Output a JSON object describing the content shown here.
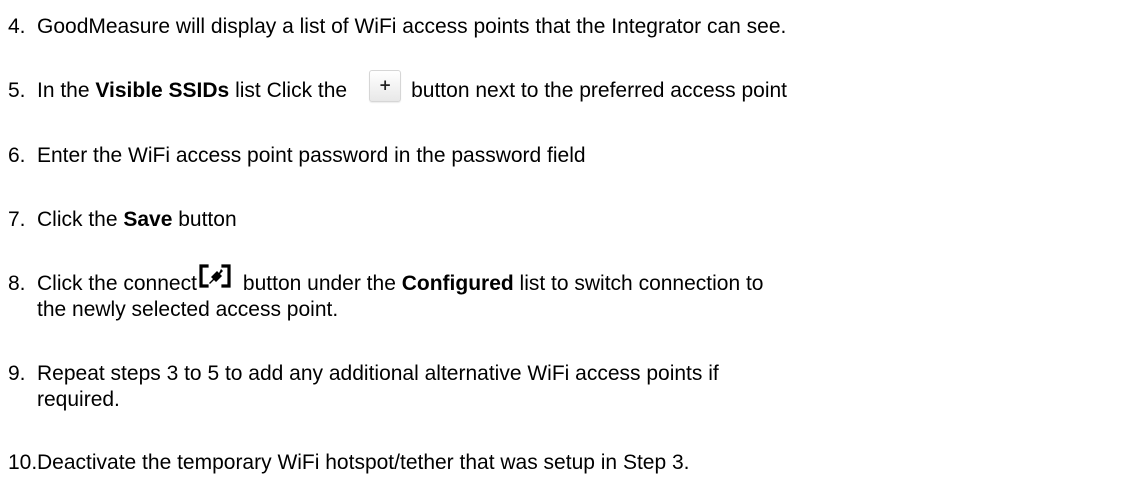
{
  "steps": [
    {
      "number": "4.",
      "text": "GoodMeasure will display a list of WiFi access points that the Integrator can see."
    },
    {
      "number": "5.",
      "pre": "In the ",
      "bold": "Visible SSIDs",
      "mid": " list Click the",
      "post": "button next to the preferred access point",
      "icon": "plus-icon",
      "icon_glyph": "+"
    },
    {
      "number": "6.",
      "text": "Enter the WiFi access point password in the password field"
    },
    {
      "number": "7.",
      "pre": "Click the ",
      "bold": "Save",
      "post": " button"
    },
    {
      "number": "8.",
      "pre": "Click the connect",
      "mid": "button under the ",
      "bold": "Configured",
      "post": " list to switch connection to",
      "line2": "the newly selected access point.",
      "icon": "connect-icon"
    },
    {
      "number": "9.",
      "line1": "Repeat steps 3 to 5 to add any additional alternative WiFi access points if",
      "line2": "required."
    },
    {
      "number": "10.",
      "text": "Deactivate the temporary WiFi hotspot/tether that was setup in Step 3."
    }
  ]
}
